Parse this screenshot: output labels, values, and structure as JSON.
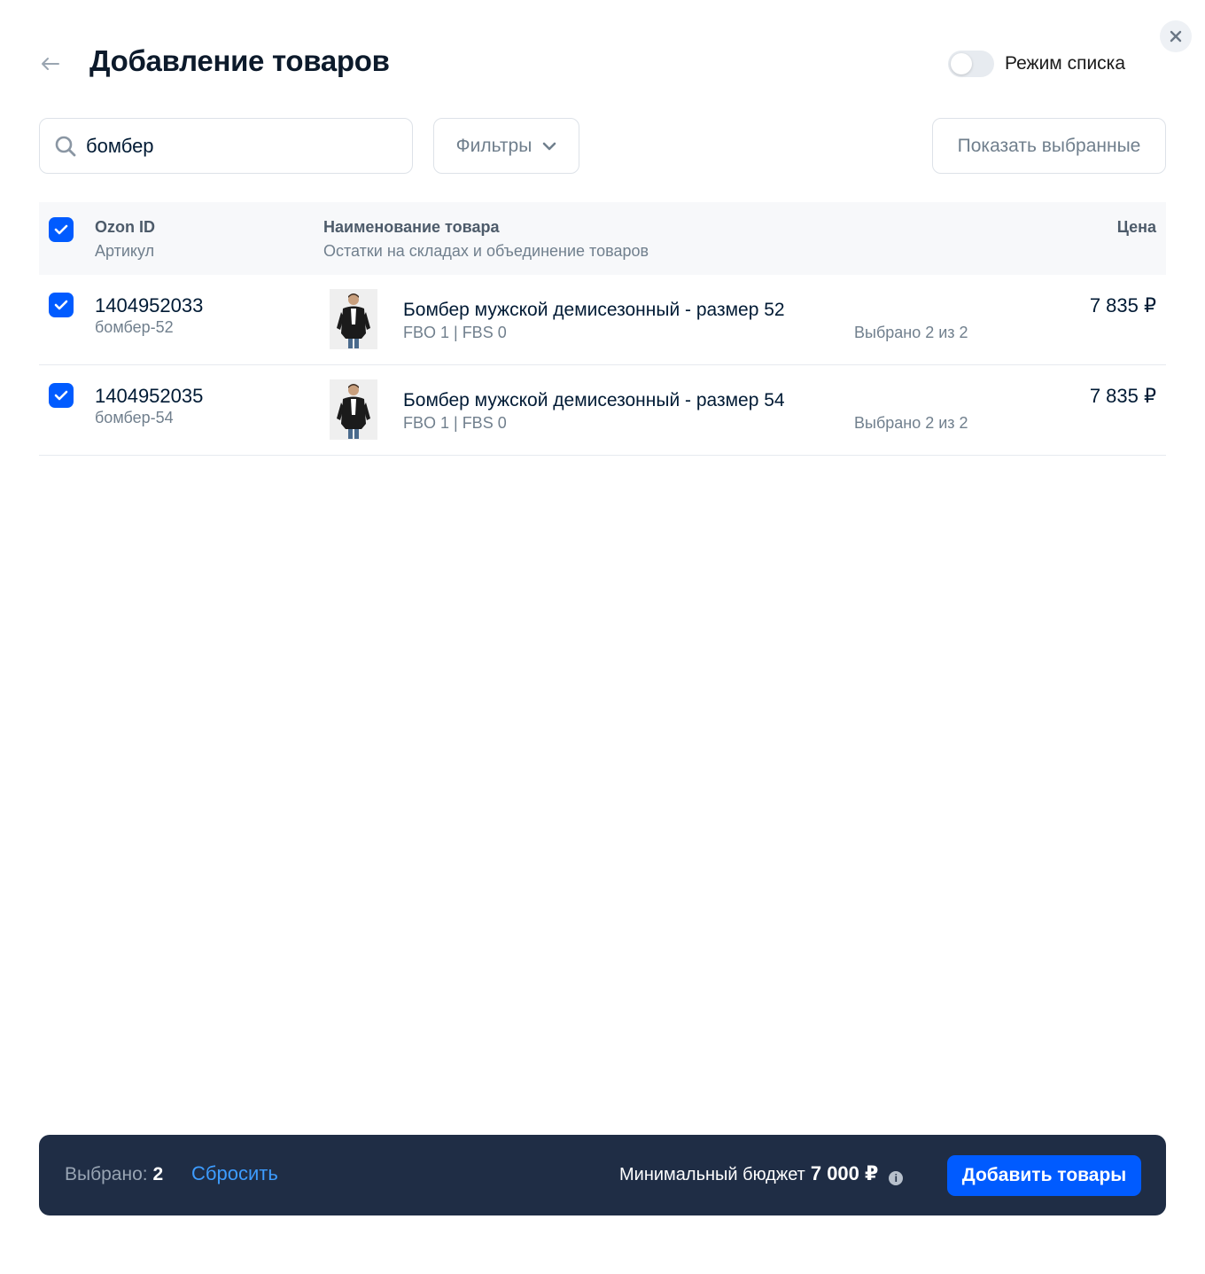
{
  "header": {
    "title": "Добавление товаров",
    "toggle_label": "Режим списка"
  },
  "toolbar": {
    "search_value": "бомбер",
    "filters_label": "Фильтры",
    "show_selected_label": "Показать выбранные"
  },
  "table": {
    "columns": {
      "id_title": "Ozon ID",
      "id_subtitle": "Артикул",
      "name_title": "Наименование товара",
      "name_subtitle": "Остатки на складах и объединение товаров",
      "price_title": "Цена"
    },
    "rows": [
      {
        "ozon_id": "1404952033",
        "sku": "бомбер-52",
        "name": "Бомбер мужской демисезонный - размер 52",
        "stock": "FBO 1 | FBS 0",
        "picked": "Выбрано 2 из 2",
        "price": "7 835 ₽",
        "checked": true
      },
      {
        "ozon_id": "1404952035",
        "sku": "бомбер-54",
        "name": "Бомбер мужской демисезонный - размер 54",
        "stock": "FBO 1 | FBS 0",
        "picked": "Выбрано 2 из 2",
        "price": "7 835 ₽",
        "checked": true
      }
    ]
  },
  "footer": {
    "selected_label": "Выбрано:",
    "selected_count": "2",
    "reset_label": "Сбросить",
    "budget_label": "Минимальный бюджет",
    "budget_value": "7 000 ₽",
    "add_button_label": "Добавить товары"
  },
  "colors": {
    "accent": "#005bff",
    "footer_bg": "#1f2d45",
    "link": "#3d9cff"
  },
  "icons": [
    "close-icon",
    "back-arrow-icon",
    "search-icon",
    "chevron-down-icon",
    "checkbox-checked-icon",
    "info-icon"
  ]
}
